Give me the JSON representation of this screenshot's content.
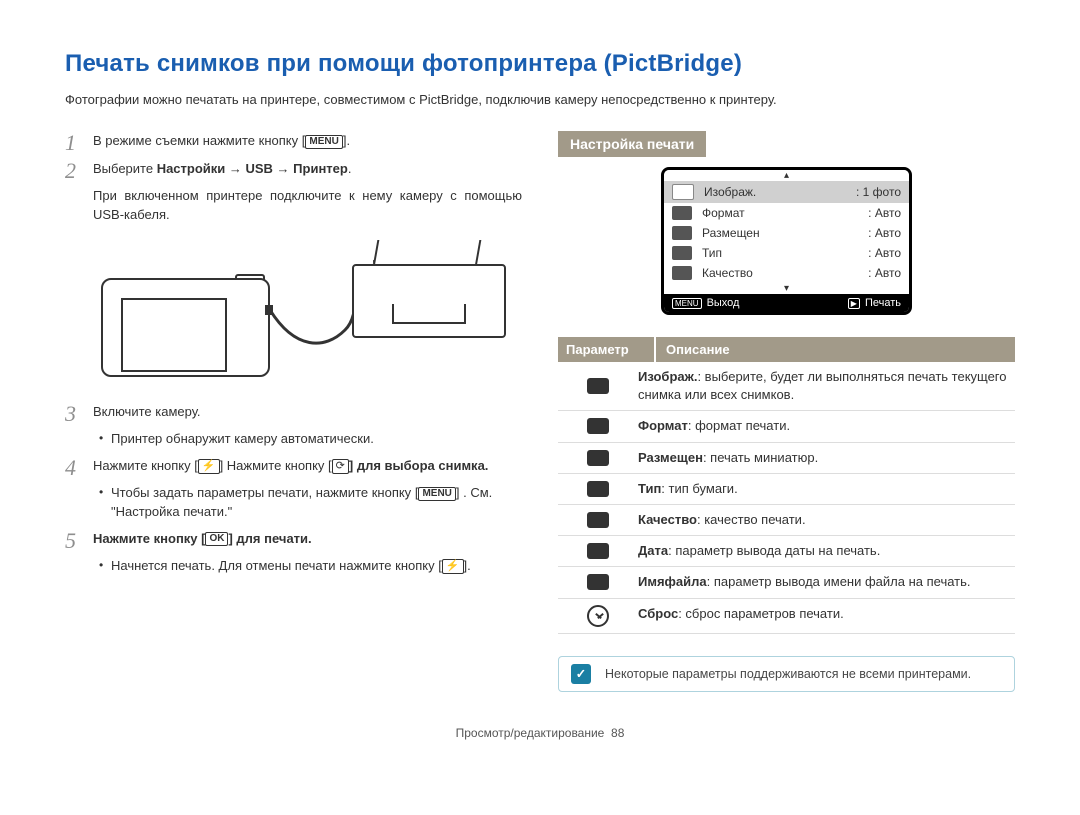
{
  "title": "Печать снимков при помощи фотопринтера (PictBridge)",
  "intro": "Фотографии можно печатать на принтере, совместимом с PictBridge, подключив камеру непосредственно к принтеру.",
  "menu_label": "MENU",
  "ok_label": "OK",
  "flash_icon": "⚡",
  "timer_icon": "⟳",
  "steps": {
    "1": "В режиме съемки нажмите кнопку ",
    "1_tail": ".",
    "2_pre": "Выберите ",
    "2_bold": "Настройки → USB → Принтер",
    "2_tail": ".",
    "2_note": "При включенном принтере подключите к нему камеру с помощью USB-кабеля.",
    "3": "Включите камеру.",
    "3_bullet": "Принтер обнаружит камеру автоматически.",
    "4_pre": "Нажмите кнопку [",
    "4_mid": "] Нажмите кнопку [",
    "4_tail": "] для выбора снимка.",
    "4_bullet_pre": "Чтобы задать параметры печати, нажмите кнопку ",
    "4_bullet_tail": " . См. \"Настройка печати.\"",
    "5_pre": "Нажмите кнопку [",
    "5_tail": "] для печати.",
    "5_bullet_pre": "Начнется печать. Для отмены печати нажмите кнопку [",
    "5_bullet_tail": "]."
  },
  "print_setup_heading": "Настройка печати",
  "screen": {
    "items": [
      {
        "label": "Изображ.",
        "value": "1 фото"
      },
      {
        "label": "Формат",
        "value": "Авто"
      },
      {
        "label": "Размещен",
        "value": "Авто"
      },
      {
        "label": "Тип",
        "value": "Авто"
      },
      {
        "label": "Качество",
        "value": "Авто"
      }
    ],
    "footer_left_icon": "MENU",
    "footer_left": "Выход",
    "footer_right_icon": "▶",
    "footer_right": "Печать"
  },
  "table": {
    "header_param": "Параметр",
    "header_desc": "Описание",
    "rows": [
      {
        "name": "Изображ.",
        "desc": ": выберите, будет ли выполняться печать текущего снимка или всех снимков."
      },
      {
        "name": "Формат",
        "desc": ": формат печати."
      },
      {
        "name": "Размещен",
        "desc": ": печать миниатюр."
      },
      {
        "name": "Тип",
        "desc": ": тип бумаги."
      },
      {
        "name": "Качество",
        "desc": ": качество печати."
      },
      {
        "name": "Дата",
        "desc": ": параметр вывода даты на печать."
      },
      {
        "name": "Имяфайла",
        "desc": ": параметр вывода имени файла на печать."
      },
      {
        "name": "Сброс",
        "desc": ": сброс параметров печати."
      }
    ]
  },
  "note_icon": "✓",
  "note_text": "Некоторые параметры поддерживаются не всеми принтерами.",
  "footer_section": "Просмотр/редактирование",
  "footer_page": "88"
}
